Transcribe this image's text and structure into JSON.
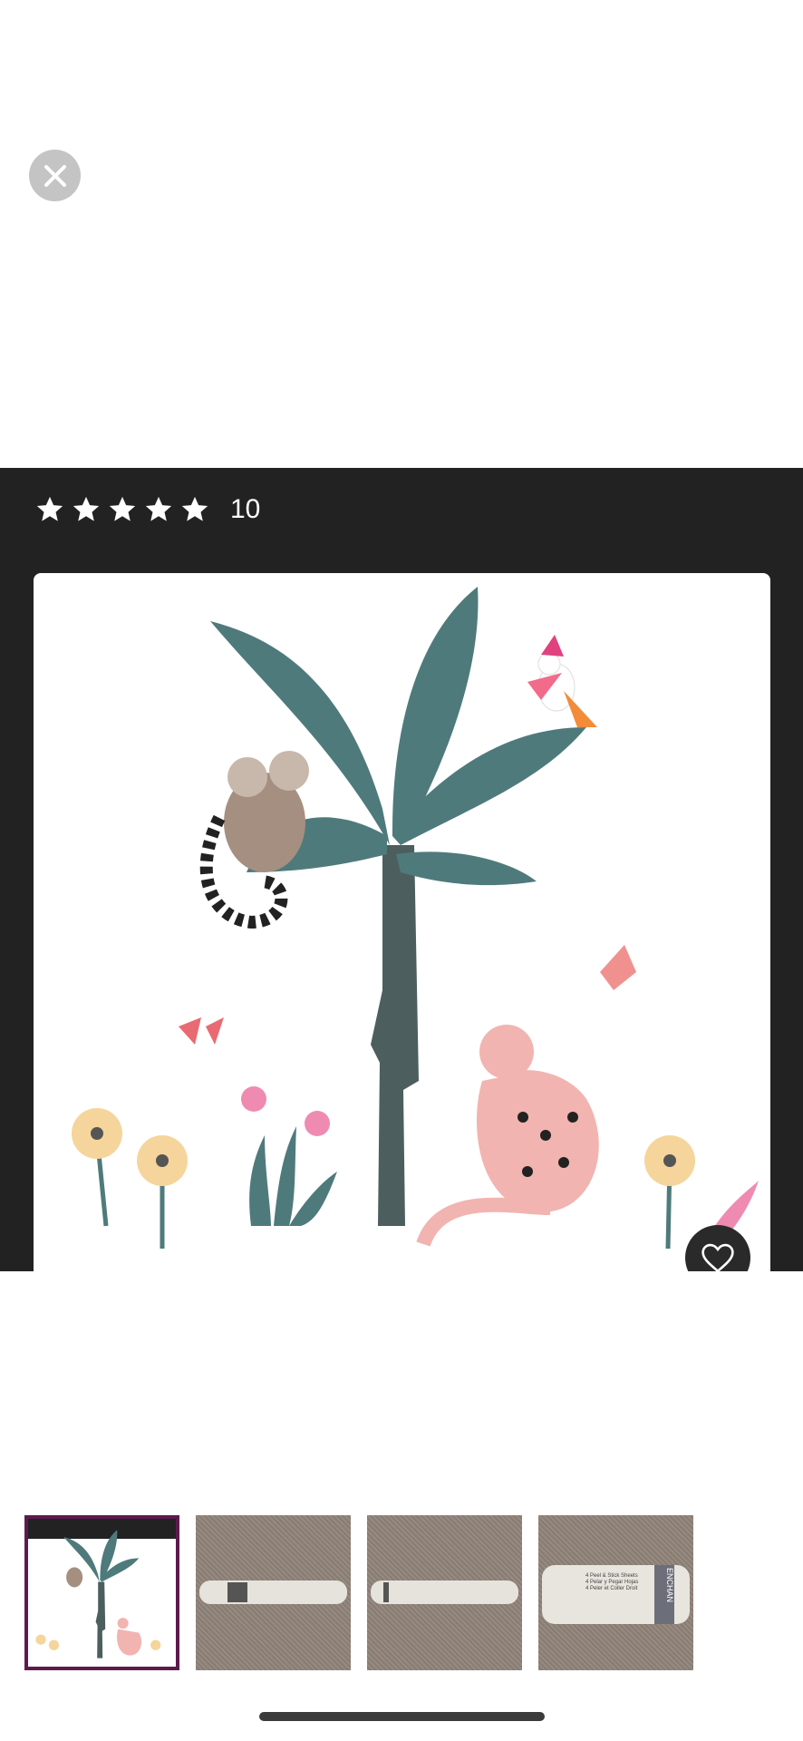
{
  "header": {
    "close_icon": "close-icon"
  },
  "product": {
    "rating": {
      "stars": 5,
      "count": "10"
    }
  },
  "gallery": {
    "favorite_icon": "heart-icon",
    "thumbnails": [
      {
        "name": "jungle-decal-illustration",
        "selected": true
      },
      {
        "name": "roll-packaging-photo-1",
        "selected": false
      },
      {
        "name": "roll-packaging-photo-2",
        "selected": false
      },
      {
        "name": "roll-packaging-photo-3",
        "selected": false
      }
    ]
  },
  "thumb4_label": {
    "line1": "4 Peel & Stick Sheets",
    "line2": "4 Pelar y Pegar Hojas",
    "line3": "4 Peler et Coller Droit",
    "brand": "ENCHAN"
  },
  "colors": {
    "dark_panel": "#222222",
    "selected_border": "#5e1a4f",
    "leaf": "#4f7a7c",
    "trunk": "#4d5e5f",
    "cheetah": "#f2b4b0"
  }
}
